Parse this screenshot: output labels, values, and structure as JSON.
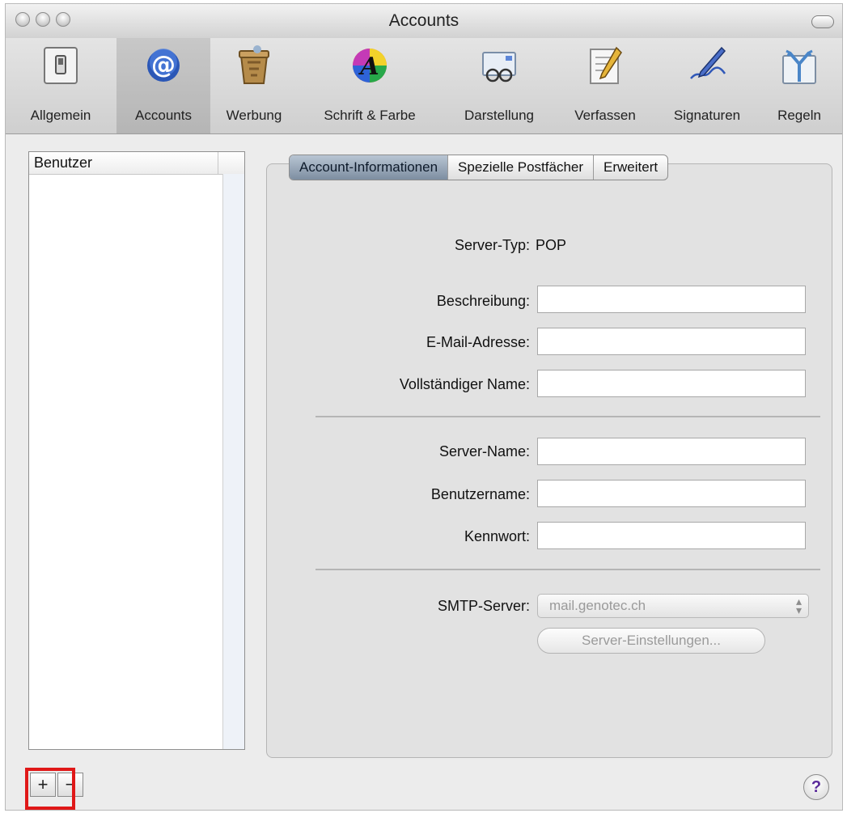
{
  "window": {
    "title": "Accounts"
  },
  "toolbar": {
    "items": [
      {
        "label": "Allgemein",
        "icon": "switch-icon"
      },
      {
        "label": "Accounts",
        "icon": "at-sign-icon",
        "selected": true
      },
      {
        "label": "Werbung",
        "icon": "trash-can-icon"
      },
      {
        "label": "Schrift & Farbe",
        "icon": "font-color-icon"
      },
      {
        "label": "Darstellung",
        "icon": "glasses-icon"
      },
      {
        "label": "Verfassen",
        "icon": "pencil-paper-icon"
      },
      {
        "label": "Signaturen",
        "icon": "pen-icon"
      },
      {
        "label": "Regeln",
        "icon": "rules-arrows-icon"
      }
    ]
  },
  "accounts_list": {
    "header": "Benutzer"
  },
  "buttons": {
    "add": "+",
    "remove": "−",
    "help": "?"
  },
  "tabs": [
    {
      "label": "Account-Informationen",
      "selected": true
    },
    {
      "label": "Spezielle Postfächer"
    },
    {
      "label": "Erweitert"
    }
  ],
  "form": {
    "server_type_label": "Server-Typ:",
    "server_type_value": "POP",
    "description_label": "Beschreibung:",
    "email_label": "E-Mail-Adresse:",
    "fullname_label": "Vollständiger Name:",
    "server_name_label": "Server-Name:",
    "username_label": "Benutzername:",
    "password_label": "Kennwort:",
    "smtp_label": "SMTP-Server:",
    "smtp_value": "mail.genotec.ch",
    "server_settings_button": "Server-Einstellungen..."
  },
  "colors": {
    "highlight": "#e01818",
    "selected_tab": "#8a9bb0"
  }
}
